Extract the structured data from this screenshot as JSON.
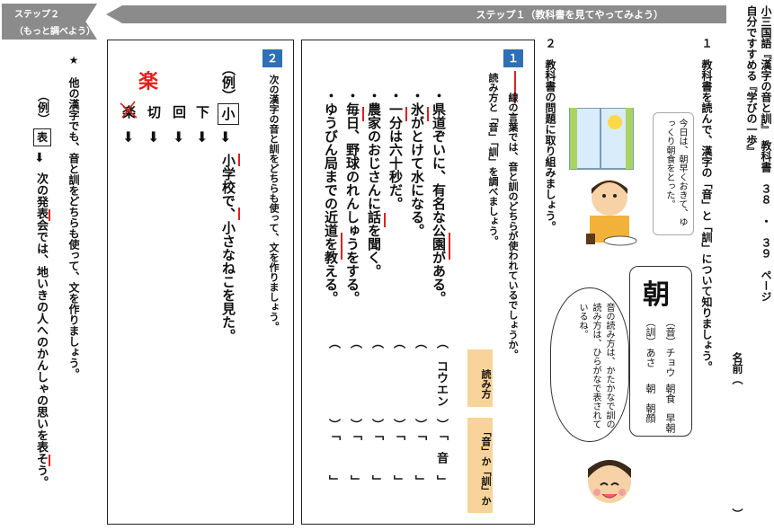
{
  "header": {
    "step2_line1": "ステップ２",
    "step2_line2": "（もっと調べよう）",
    "step1_title": "ステップ１（教科書を見てやってみよう）"
  },
  "right_column": {
    "line1": "自分ですすめる『学びの一歩』",
    "line2": "小三国語『漢字の音と訓』　教科書　３８　・　３９　ページ",
    "name_label": "名前（",
    "name_close": "）"
  },
  "section1": {
    "text": "１　教科書を読んで、漢字の「音」と「訓」について知りましょう。",
    "picture_caption": "今日は、朝早くおきて、ゆっくり朝食をとった。",
    "kanji_card": {
      "kanji": "朝",
      "on_label": "（音）",
      "on_reading": "チョウ",
      "on_examples": "朝食　早朝",
      "kun_label": "（訓）",
      "kun_reading": "あさ",
      "kun_examples": "朝　朝顔"
    },
    "speech": "音の読み方は、かたかなで訓の読み方は、ひらがなで表されているね。"
  },
  "section2_intro": "２　教科書の問題に取り組みましょう。",
  "box1": {
    "badge": "１",
    "instruction1": "　　線の言葉では、音と訓のどちらが使われているでしょうか。",
    "instruction2": "読み方と「音」「訓」を調べましょう。",
    "header_reading": "読み方",
    "header_type": "「音」か「訓」か",
    "sentences": [
      "・県道ぞいに、有名な公園がある。",
      "・氷がとけて水になる。",
      "・一分は六十秒だ。",
      "・農家のおじさんに話を聞く。",
      "・毎日、野球のれんしゅうをする。",
      "・ゆうびん局までの近道を教える。"
    ],
    "answers": [
      {
        "reading": "（　コウエン　）",
        "type": "「　音　」"
      },
      {
        "reading": "（　　　　　　）",
        "type": "「　　　」"
      },
      {
        "reading": "（　　　　　　）",
        "type": "「　　　」"
      },
      {
        "reading": "（　　　　　　）",
        "type": "「　　　」"
      },
      {
        "reading": "（　　　　　　）",
        "type": "「　　　」"
      },
      {
        "reading": "（　　　　　　）",
        "type": "「　　　」"
      }
    ]
  },
  "box2": {
    "badge": "２",
    "instruction": "次の漢字の音と訓をどちらも使って、文を作りましょう。",
    "example_label": "（例）",
    "example_kanji": "小",
    "example_sentence": "小学校で、小さなねこを見た。",
    "kanji_list": [
      "下",
      "回",
      "切",
      "楽"
    ],
    "red_kanji": "楽",
    "arrow": "⬇"
  },
  "step2": {
    "instruction": "★　他の漢字でも、音と訓をどちらも使って、文を作りましょう。",
    "example_label": "（例）",
    "example_kanji": "表",
    "arrow": "⬇",
    "example_sentence": "次の発表会では、地いきの人へのかんしゃの思いを表そう。"
  },
  "colors": {
    "gray": "#8b8b8b",
    "badge_blue": "#2e6fb5",
    "answer_header": "#f8d49a",
    "mark_red": "#e0201c"
  }
}
